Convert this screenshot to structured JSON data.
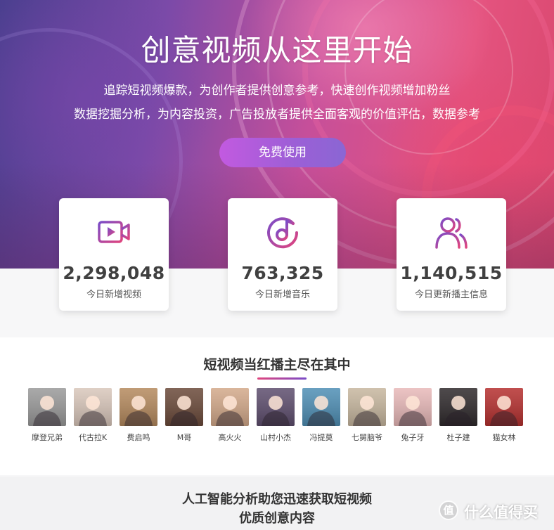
{
  "hero": {
    "title": "创意视频从这里开始",
    "line1": "追踪短视频爆款，为创作者提供创意参考，快速创作视频增加粉丝",
    "line2": "数据挖掘分析，为内容投资，广告投放者提供全面客观的价值评估，数据参考",
    "cta_label": "免费使用"
  },
  "stats": [
    {
      "value": "2,298,048",
      "label": "今日新增视频",
      "icon": "video-camera-icon"
    },
    {
      "value": "763,325",
      "label": "今日新增音乐",
      "icon": "music-disc-icon"
    },
    {
      "value": "1,140,515",
      "label": "今日更新播主信息",
      "icon": "users-icon"
    }
  ],
  "creators_section": {
    "title": "短视频当红播主尽在其中",
    "creators": [
      {
        "name": "摩登兄弟",
        "color": "#9a9a9a"
      },
      {
        "name": "代古拉K",
        "color": "#d9c7bb"
      },
      {
        "name": "费启鸣",
        "color": "#b58a5e"
      },
      {
        "name": "M哥",
        "color": "#6b4a3a"
      },
      {
        "name": "高火火",
        "color": "#d3a98a"
      },
      {
        "name": "山村小杰",
        "color": "#5e4e6e"
      },
      {
        "name": "冯提莫",
        "color": "#4f8fb5"
      },
      {
        "name": "七舅脑爷",
        "color": "#c7b79f"
      },
      {
        "name": "兔子牙",
        "color": "#e8b9b9"
      },
      {
        "name": "杜子建",
        "color": "#2f2a2c"
      },
      {
        "name": "猫女林",
        "color": "#b5302f"
      }
    ]
  },
  "bottom": {
    "line1": "人工智能分析助您迅速获取短视频",
    "line2": "优质创意内容"
  },
  "watermark": {
    "badge": "值",
    "text": "什么值得买"
  },
  "colors": {
    "accent_start": "#e0457e",
    "accent_end": "#7a4cc8",
    "cta": "#b35ce0"
  }
}
